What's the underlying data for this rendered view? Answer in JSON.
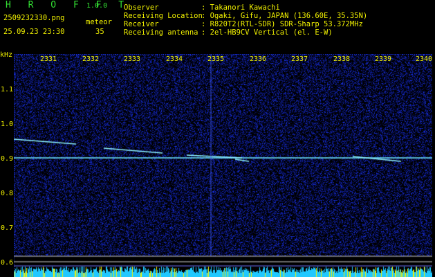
{
  "header": {
    "app_title": "H R O F F T",
    "app_version": "1.0.0",
    "file_name": "2509232330.png",
    "timestamp": "25.09.23 23:30",
    "meteor_label": "meteor",
    "meteor_count": "35",
    "info": [
      {
        "key": "Observer",
        "value": ": Takanori Kawachi"
      },
      {
        "key": "Receiving Location",
        "value": ": Ogaki, Gifu, JAPAN (136.60E, 35.35N)"
      },
      {
        "key": "Receiver",
        "value": ": R820T2(RTL-SDR) SDR-Sharp 53.372MHz"
      },
      {
        "key": "Receiving antenna",
        "value": ": 2el-HB9CV Vertical (el. E-W)"
      }
    ]
  },
  "axis": {
    "y_unit": "kHz",
    "y_ticks": [
      "1.1",
      "1.0",
      "0.9",
      "0.8",
      "0.7",
      "0.6"
    ],
    "x_ticks": [
      "2331",
      "2332",
      "2333",
      "2334",
      "2335",
      "2336",
      "2337",
      "2338",
      "2339",
      "2340"
    ]
  },
  "colors": {
    "background": "#000000",
    "label_yellow": "#f2f200",
    "title_green": "#33e033",
    "noise_blue": "#1a2fd0",
    "signal_cyan": "#80f0ff",
    "bottom_bar_cyan": "#20c8ff"
  }
}
